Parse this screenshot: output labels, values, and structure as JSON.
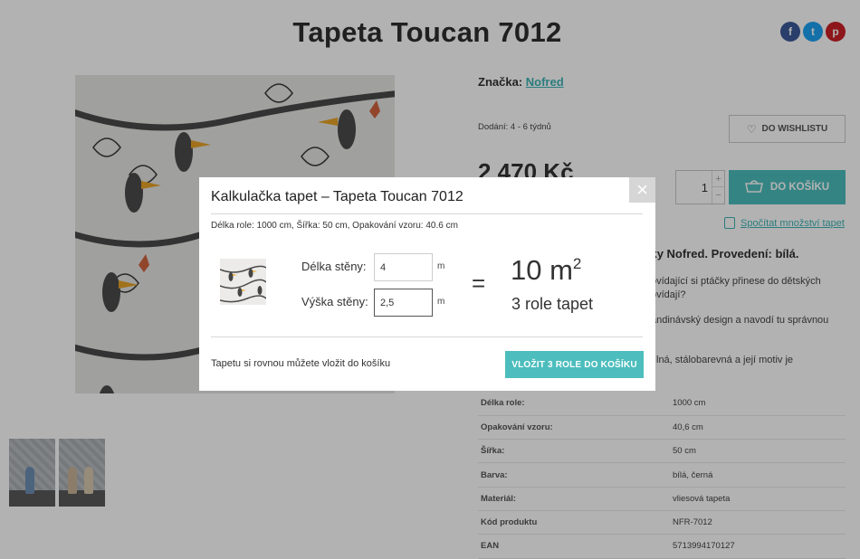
{
  "page": {
    "title": "Tapeta Toucan 7012",
    "social": {
      "facebook": "f",
      "twitter": "t",
      "pinterest": "p"
    },
    "brand": {
      "label": "Značka:",
      "name": "Nofred"
    },
    "delivery": "Dodání: 4 - 6 týdnů",
    "wishlist_label": "DO WISHLISTU",
    "price": "2 470 Kč",
    "quantity": "1",
    "cart_label": "DO KOŠÍKU",
    "calc_link": "Spočítat množství tapet",
    "desc_line1": "áčky Nofred. Provedení: bílá.",
    "desc_line2a": "ovídající si ptáčky přinese do dětských",
    "desc_line2b": "ovídají?",
    "desc_line3": "andinávský design a navodí tu správnou",
    "desc_line4": "lná, stálobarevná a její motiv je",
    "params": [
      {
        "key": "Délka role:",
        "value": "1000 cm"
      },
      {
        "key": "Opakování vzoru:",
        "value": "40,6 cm"
      },
      {
        "key": "Šířka:",
        "value": "50 cm"
      },
      {
        "key": "Barva:",
        "value": "bílá, černá"
      },
      {
        "key": "Materiál:",
        "value": "vliesová tapeta"
      },
      {
        "key": "Kód produktu",
        "value": "NFR-7012"
      },
      {
        "key": "EAN",
        "value": "5713994170127"
      }
    ]
  },
  "modal": {
    "title": "Kalkulačka tapet – Tapeta Toucan 7012",
    "close_glyph": "×",
    "info": "Délka role: 1000 cm, Šířka: 50 cm, Opakování vzoru: 40.6 cm",
    "length_label": "Délka stěny:",
    "length_value": "4",
    "height_label": "Výška stěny:",
    "height_value": "2,5",
    "unit": "m",
    "equals": "=",
    "area_value": "10 m",
    "area_exp": "2",
    "rolls": "3 role tapet",
    "note": "Tapetu si rovnou můžete vložit do košíku",
    "cta": "VLOŽIT 3 ROLE DO KOŠÍKU"
  },
  "colors": {
    "accent": "#4dbdbd",
    "link": "#3fb3b5",
    "overlay": "rgba(0,0,0,0.3)"
  },
  "icons": [
    "facebook-icon",
    "twitter-icon",
    "pinterest-icon",
    "heart-icon",
    "cart-icon",
    "calculator-icon",
    "close-icon"
  ]
}
